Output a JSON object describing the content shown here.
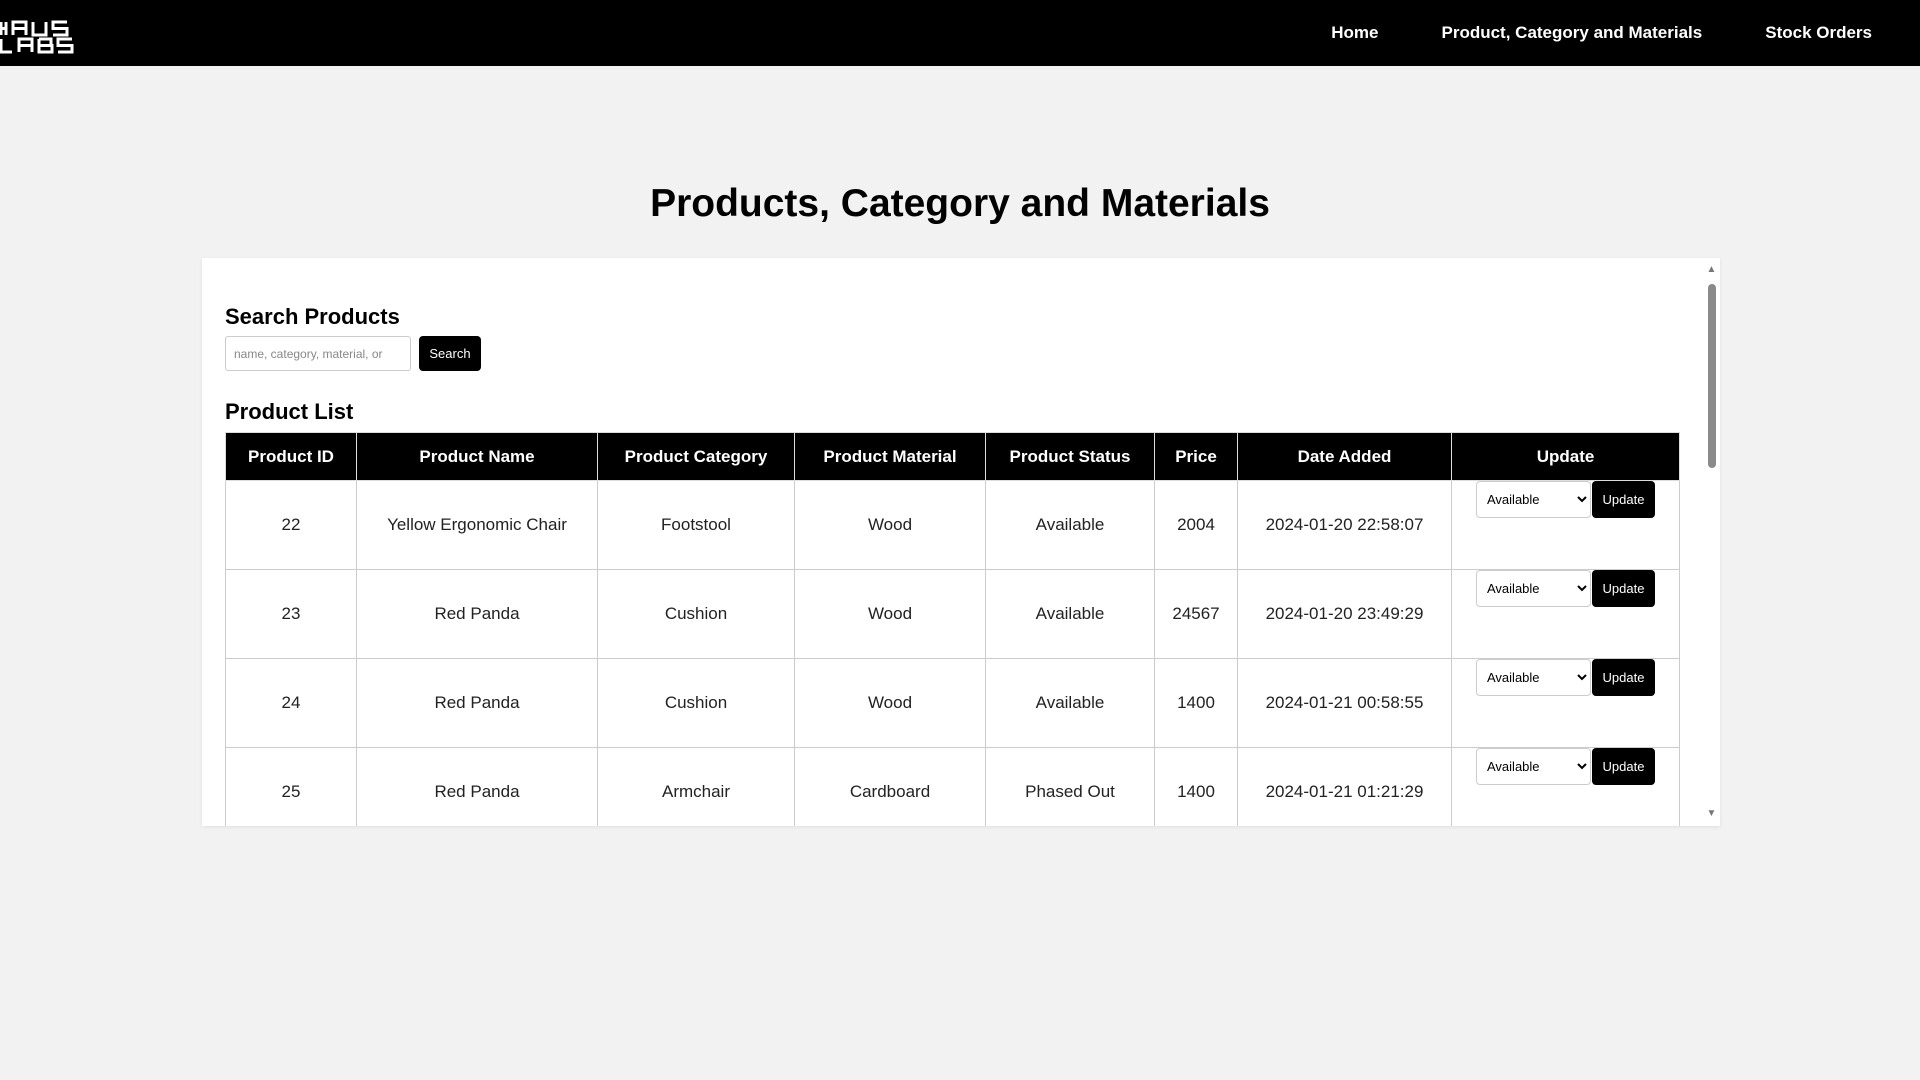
{
  "nav": {
    "links": [
      "Home",
      "Product, Category and Materials",
      "Stock Orders"
    ]
  },
  "page": {
    "title": "Products, Category and Materials"
  },
  "search": {
    "heading": "Search Products",
    "placeholder": "name, category, material, or",
    "button_label": "Search"
  },
  "list": {
    "heading": "Product List",
    "columns": [
      "Product ID",
      "Product Name",
      "Product Category",
      "Product Material",
      "Product Status",
      "Price",
      "Date Added",
      "Update"
    ],
    "rows": [
      {
        "id": "22",
        "name": "Yellow Ergonomic Chair",
        "category": "Footstool",
        "material": "Wood",
        "status": "Available",
        "price": "2004",
        "date": "2024-01-20 22:58:07",
        "select_value": "Available",
        "button_label": "Update"
      },
      {
        "id": "23",
        "name": "Red Panda",
        "category": "Cushion",
        "material": "Wood",
        "status": "Available",
        "price": "24567",
        "date": "2024-01-20 23:49:29",
        "select_value": "Available",
        "button_label": "Update"
      },
      {
        "id": "24",
        "name": "Red Panda",
        "category": "Cushion",
        "material": "Wood",
        "status": "Available",
        "price": "1400",
        "date": "2024-01-21 00:58:55",
        "select_value": "Available",
        "button_label": "Update"
      },
      {
        "id": "25",
        "name": "Red Panda",
        "category": "Armchair",
        "material": "Cardboard",
        "status": "Phased Out",
        "price": "1400",
        "date": "2024-01-21 01:21:29",
        "select_value": "Available",
        "button_label": "Update"
      }
    ]
  },
  "colors": {
    "nav_background": "#000000",
    "page_background": "#f2f2f2",
    "accent": "#000000"
  },
  "icons": {
    "logo": "haus-labs-logo",
    "scroll_up": "triangle-up-icon",
    "scroll_down": "triangle-down-icon"
  }
}
